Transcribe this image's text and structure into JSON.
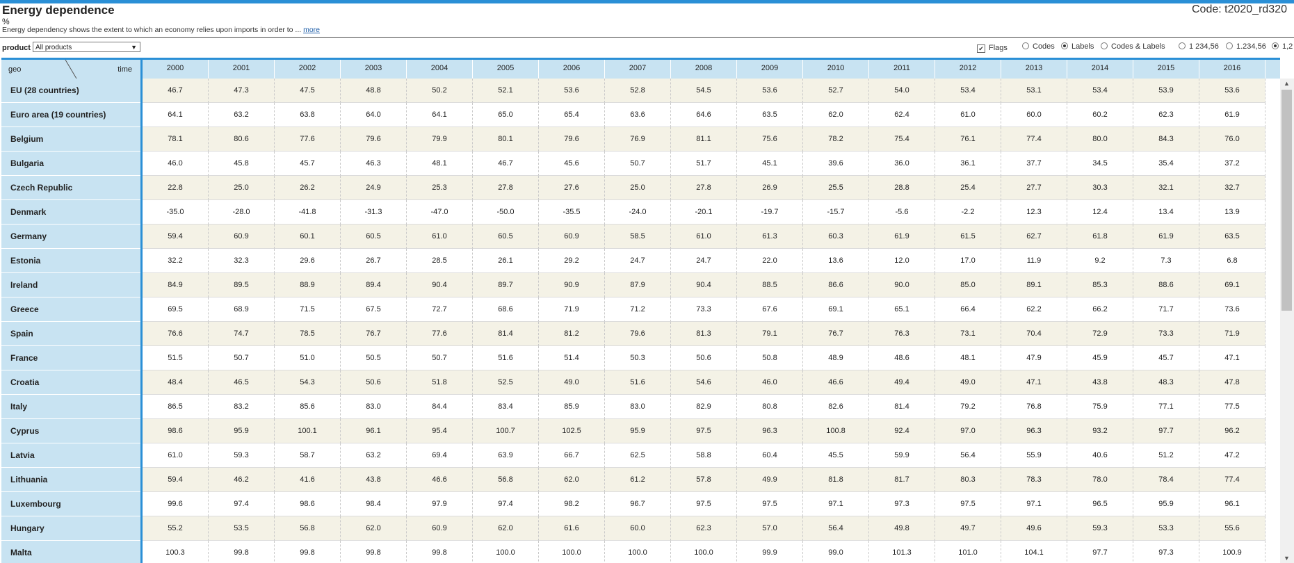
{
  "header": {
    "title": "Energy dependence",
    "code": "Code: t2020_rd320",
    "unit": "%",
    "description": "Energy dependency shows the extent to which an economy relies upon imports in order to ...",
    "more_link": "more"
  },
  "filters": {
    "product_label": "product",
    "product_value": "All products"
  },
  "display_options": {
    "flags": "Flags",
    "codes": "Codes",
    "labels": "Labels",
    "codes_labels": "Codes & Labels",
    "fmt1": "1 234,56",
    "fmt2": "1.234,56",
    "fmt3": "1,2"
  },
  "table": {
    "geo_header": "geo",
    "time_header": "time",
    "years": [
      "2000",
      "2001",
      "2002",
      "2003",
      "2004",
      "2005",
      "2006",
      "2007",
      "2008",
      "2009",
      "2010",
      "2011",
      "2012",
      "2013",
      "2014",
      "2015",
      "2016"
    ],
    "rows": [
      {
        "geo": "EU (28 countries)",
        "values": [
          "46.7",
          "47.3",
          "47.5",
          "48.8",
          "50.2",
          "52.1",
          "53.6",
          "52.8",
          "54.5",
          "53.6",
          "52.7",
          "54.0",
          "53.4",
          "53.1",
          "53.4",
          "53.9",
          "53.6"
        ]
      },
      {
        "geo": "Euro area (19 countries)",
        "values": [
          "64.1",
          "63.2",
          "63.8",
          "64.0",
          "64.1",
          "65.0",
          "65.4",
          "63.6",
          "64.6",
          "63.5",
          "62.0",
          "62.4",
          "61.0",
          "60.0",
          "60.2",
          "62.3",
          "61.9"
        ]
      },
      {
        "geo": "Belgium",
        "values": [
          "78.1",
          "80.6",
          "77.6",
          "79.6",
          "79.9",
          "80.1",
          "79.6",
          "76.9",
          "81.1",
          "75.6",
          "78.2",
          "75.4",
          "76.1",
          "77.4",
          "80.0",
          "84.3",
          "76.0"
        ]
      },
      {
        "geo": "Bulgaria",
        "values": [
          "46.0",
          "45.8",
          "45.7",
          "46.3",
          "48.1",
          "46.7",
          "45.6",
          "50.7",
          "51.7",
          "45.1",
          "39.6",
          "36.0",
          "36.1",
          "37.7",
          "34.5",
          "35.4",
          "37.2"
        ]
      },
      {
        "geo": "Czech Republic",
        "values": [
          "22.8",
          "25.0",
          "26.2",
          "24.9",
          "25.3",
          "27.8",
          "27.6",
          "25.0",
          "27.8",
          "26.9",
          "25.5",
          "28.8",
          "25.4",
          "27.7",
          "30.3",
          "32.1",
          "32.7"
        ]
      },
      {
        "geo": "Denmark",
        "values": [
          "-35.0",
          "-28.0",
          "-41.8",
          "-31.3",
          "-47.0",
          "-50.0",
          "-35.5",
          "-24.0",
          "-20.1",
          "-19.7",
          "-15.7",
          "-5.6",
          "-2.2",
          "12.3",
          "12.4",
          "13.4",
          "13.9"
        ]
      },
      {
        "geo": "Germany",
        "values": [
          "59.4",
          "60.9",
          "60.1",
          "60.5",
          "61.0",
          "60.5",
          "60.9",
          "58.5",
          "61.0",
          "61.3",
          "60.3",
          "61.9",
          "61.5",
          "62.7",
          "61.8",
          "61.9",
          "63.5"
        ]
      },
      {
        "geo": "Estonia",
        "values": [
          "32.2",
          "32.3",
          "29.6",
          "26.7",
          "28.5",
          "26.1",
          "29.2",
          "24.7",
          "24.7",
          "22.0",
          "13.6",
          "12.0",
          "17.0",
          "11.9",
          "9.2",
          "7.3",
          "6.8"
        ]
      },
      {
        "geo": "Ireland",
        "values": [
          "84.9",
          "89.5",
          "88.9",
          "89.4",
          "90.4",
          "89.7",
          "90.9",
          "87.9",
          "90.4",
          "88.5",
          "86.6",
          "90.0",
          "85.0",
          "89.1",
          "85.3",
          "88.6",
          "69.1"
        ]
      },
      {
        "geo": "Greece",
        "values": [
          "69.5",
          "68.9",
          "71.5",
          "67.5",
          "72.7",
          "68.6",
          "71.9",
          "71.2",
          "73.3",
          "67.6",
          "69.1",
          "65.1",
          "66.4",
          "62.2",
          "66.2",
          "71.7",
          "73.6"
        ]
      },
      {
        "geo": "Spain",
        "values": [
          "76.6",
          "74.7",
          "78.5",
          "76.7",
          "77.6",
          "81.4",
          "81.2",
          "79.6",
          "81.3",
          "79.1",
          "76.7",
          "76.3",
          "73.1",
          "70.4",
          "72.9",
          "73.3",
          "71.9"
        ]
      },
      {
        "geo": "France",
        "values": [
          "51.5",
          "50.7",
          "51.0",
          "50.5",
          "50.7",
          "51.6",
          "51.4",
          "50.3",
          "50.6",
          "50.8",
          "48.9",
          "48.6",
          "48.1",
          "47.9",
          "45.9",
          "45.7",
          "47.1"
        ]
      },
      {
        "geo": "Croatia",
        "values": [
          "48.4",
          "46.5",
          "54.3",
          "50.6",
          "51.8",
          "52.5",
          "49.0",
          "51.6",
          "54.6",
          "46.0",
          "46.6",
          "49.4",
          "49.0",
          "47.1",
          "43.8",
          "48.3",
          "47.8"
        ]
      },
      {
        "geo": "Italy",
        "values": [
          "86.5",
          "83.2",
          "85.6",
          "83.0",
          "84.4",
          "83.4",
          "85.9",
          "83.0",
          "82.9",
          "80.8",
          "82.6",
          "81.4",
          "79.2",
          "76.8",
          "75.9",
          "77.1",
          "77.5"
        ]
      },
      {
        "geo": "Cyprus",
        "values": [
          "98.6",
          "95.9",
          "100.1",
          "96.1",
          "95.4",
          "100.7",
          "102.5",
          "95.9",
          "97.5",
          "96.3",
          "100.8",
          "92.4",
          "97.0",
          "96.3",
          "93.2",
          "97.7",
          "96.2"
        ]
      },
      {
        "geo": "Latvia",
        "values": [
          "61.0",
          "59.3",
          "58.7",
          "63.2",
          "69.4",
          "63.9",
          "66.7",
          "62.5",
          "58.8",
          "60.4",
          "45.5",
          "59.9",
          "56.4",
          "55.9",
          "40.6",
          "51.2",
          "47.2"
        ]
      },
      {
        "geo": "Lithuania",
        "values": [
          "59.4",
          "46.2",
          "41.6",
          "43.8",
          "46.6",
          "56.8",
          "62.0",
          "61.2",
          "57.8",
          "49.9",
          "81.8",
          "81.7",
          "80.3",
          "78.3",
          "78.0",
          "78.4",
          "77.4"
        ]
      },
      {
        "geo": "Luxembourg",
        "values": [
          "99.6",
          "97.4",
          "98.6",
          "98.4",
          "97.9",
          "97.4",
          "98.2",
          "96.7",
          "97.5",
          "97.5",
          "97.1",
          "97.3",
          "97.5",
          "97.1",
          "96.5",
          "95.9",
          "96.1"
        ]
      },
      {
        "geo": "Hungary",
        "values": [
          "55.2",
          "53.5",
          "56.8",
          "62.0",
          "60.9",
          "62.0",
          "61.6",
          "60.0",
          "62.3",
          "57.0",
          "56.4",
          "49.8",
          "49.7",
          "49.6",
          "59.3",
          "53.3",
          "55.6"
        ]
      },
      {
        "geo": "Malta",
        "values": [
          "100.3",
          "99.8",
          "99.8",
          "99.8",
          "99.8",
          "100.0",
          "100.0",
          "100.0",
          "100.0",
          "99.9",
          "99.0",
          "101.3",
          "101.0",
          "104.1",
          "97.7",
          "97.3",
          "100.9"
        ]
      }
    ]
  },
  "colors": {
    "accent": "#2a8fd6",
    "header_bg": "#c8e3f2",
    "row_odd": "#f4f2e6"
  }
}
